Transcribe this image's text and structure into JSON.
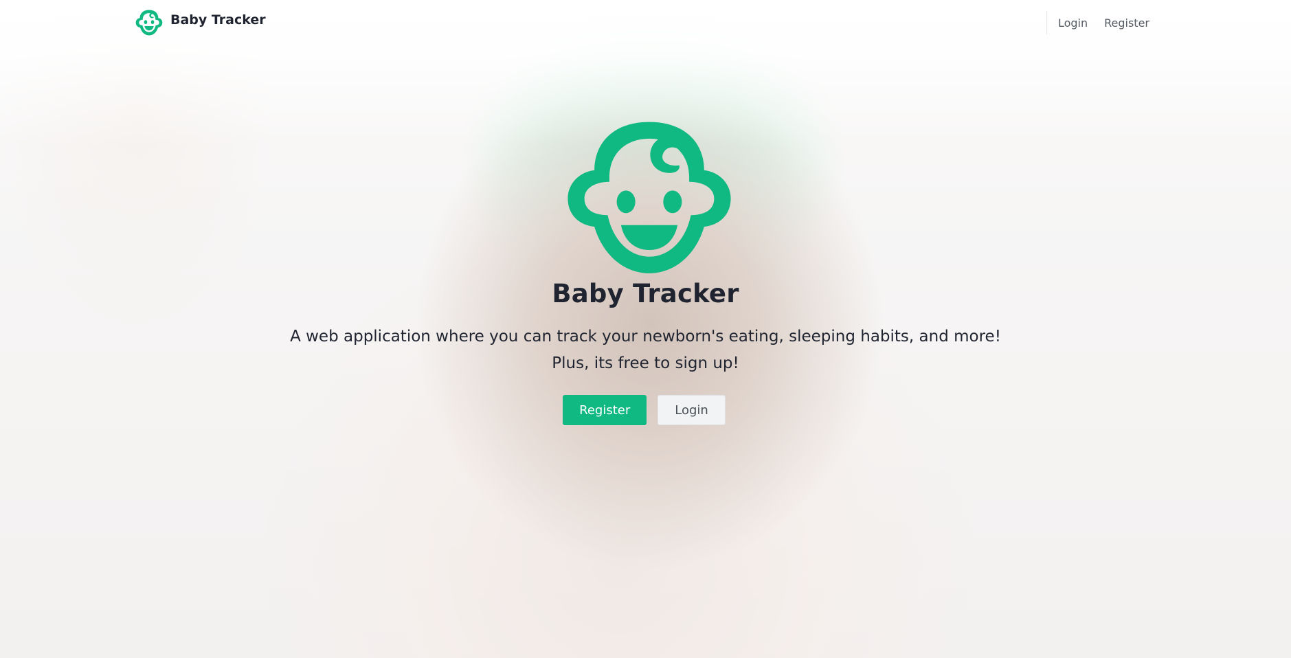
{
  "colors": {
    "brand": "#10b981",
    "text": "#1f2430",
    "nav_text": "#555b63"
  },
  "navbar": {
    "brand": {
      "icon": "baby-face-icon",
      "label": "Baby Tracker"
    },
    "links": {
      "login": "Login",
      "register": "Register"
    }
  },
  "hero": {
    "icon": "baby-face-icon",
    "title": "Baby Tracker",
    "tagline_line1": "A web application where you can track your newborn's eating, sleeping habits, and more!",
    "tagline_line2": "Plus, its free to sign up!",
    "buttons": {
      "register": "Register",
      "login": "Login"
    }
  }
}
